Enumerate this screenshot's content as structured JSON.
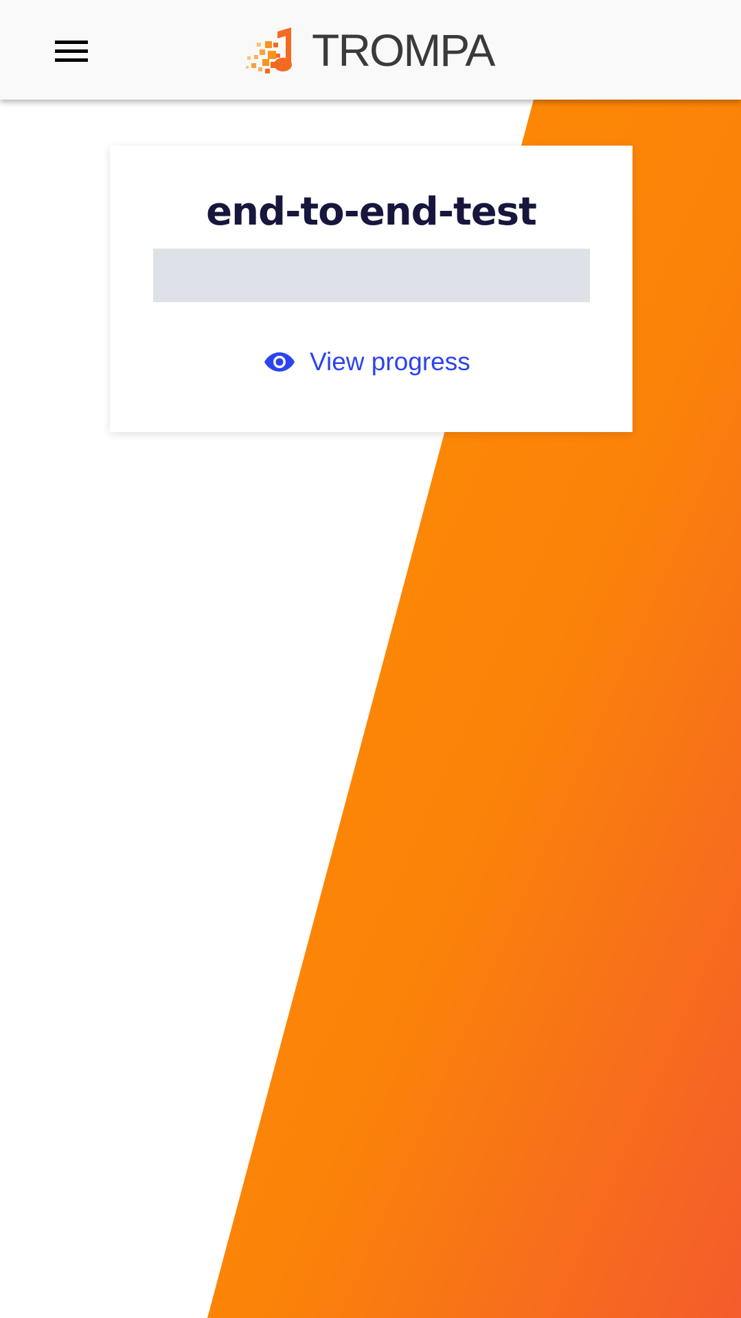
{
  "header": {
    "menu_icon": "hamburger-menu-icon",
    "logo_icon": "music-note-pixel-icon",
    "logo_text": "TROMPA",
    "brand_color": "#f26b21"
  },
  "card": {
    "title": "end-to-end-test",
    "progress": 0,
    "view_link": {
      "icon": "eye-icon",
      "label": "View progress",
      "color": "#2c43ee"
    }
  },
  "background": {
    "accent_start": "#ff8c00",
    "accent_end": "#f45f2c"
  }
}
